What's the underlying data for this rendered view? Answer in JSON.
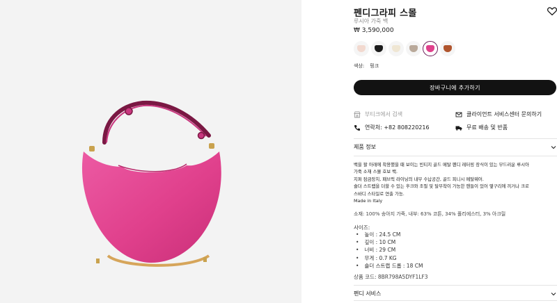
{
  "product": {
    "title": "펜디그라피 스몰",
    "subtitle": "루시아 가죽 백",
    "price": "₩ 3,590,000"
  },
  "swatches": [
    {
      "name": "light-pink",
      "color": "#f2d9cf"
    },
    {
      "name": "black",
      "color": "#1c1c1c"
    },
    {
      "name": "cream",
      "color": "#efe6d3"
    },
    {
      "name": "taupe",
      "color": "#b9a99a"
    },
    {
      "name": "pink",
      "color": "#e0408c",
      "selected": true
    },
    {
      "name": "brown",
      "color": "#b0552e"
    }
  ],
  "color": {
    "label": "색상:",
    "value": "핑크"
  },
  "cart_button": "장바구니에 추가하기",
  "services": {
    "boutique": "부티크에서 검색",
    "client_service": "클라이언트 서비스센터 문의하기",
    "phone": "연락처: +82 808220216",
    "shipping": "무료 배송 및 반품"
  },
  "product_info": {
    "heading": "제품 정보",
    "description": [
      "백을 팔 아래에 착용했을 때 보이는 빈티지 골드 메탈 펜디 레터링 장식이 있는 부드러운 루시아",
      "가죽 소재 스몰 호보 백.",
      "지퍼 잠금장치, 패브릭 라이닝의 내부 수납공간, 골드 피니시 메탈웨어.",
      "숄더 스트랩을 더할 수 있는 후크와 조절 및 탈부착이 가능한 핸들이 있어 옆구리에 끼거나 크로",
      "스바디 스타일로 연출 가능.",
      "Made in Italy"
    ],
    "material": "소재: 100% 송아지 가죽, 내부: 63% 코튼, 34% 폴리에스터, 3% 아크릴",
    "size_label": "사이즈:",
    "sizes": [
      "높이 : 24.5 CM",
      "깊이 : 10 CM",
      "너비 : 29 CM",
      "무게 : 0.7 KG",
      "숄더 스트랩 드롭 : 18 CM"
    ],
    "code": "상품 코드: 8BR798A5DYF1LF3"
  },
  "fendi_services": {
    "heading": "펜디 서비스"
  },
  "colors": {
    "bag": "#e24592",
    "accent_selected": "#6b1a57",
    "button_bg": "#121212"
  }
}
